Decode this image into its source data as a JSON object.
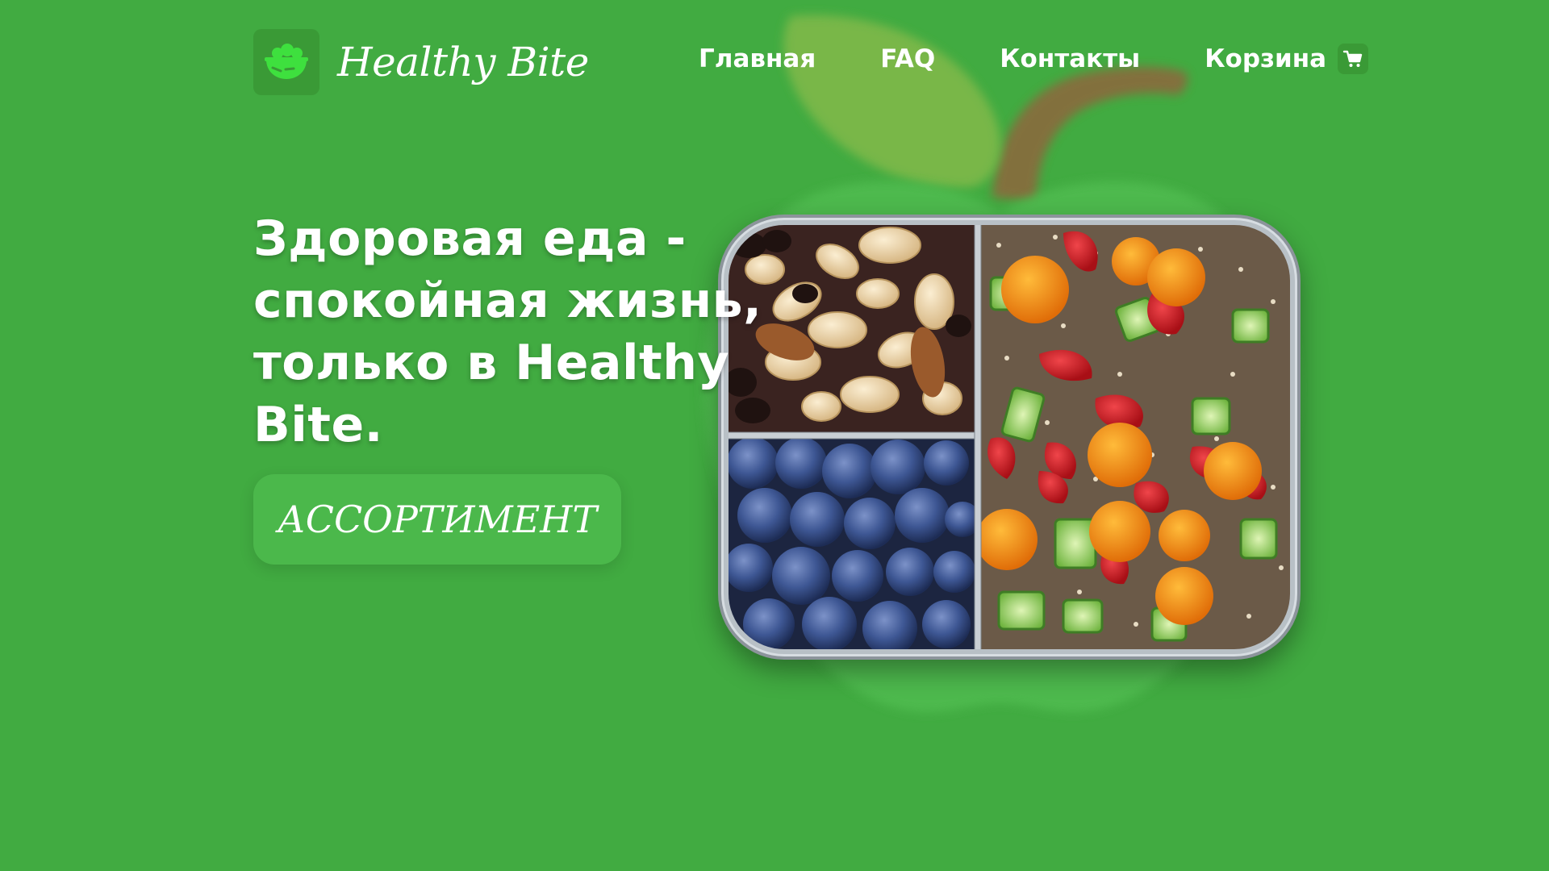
{
  "brand": {
    "name": "Healthy Bite",
    "logo_icon": "salad-bowl-icon"
  },
  "nav": {
    "items": [
      {
        "label": "Главная"
      },
      {
        "label": "FAQ"
      },
      {
        "label": "Контакты"
      },
      {
        "label": "Корзина"
      }
    ],
    "cart_icon": "cart-icon"
  },
  "hero": {
    "title": "Здоровая еда - спокойная жизнь, только в Healthy Bite.",
    "cta_label": "АССОРТИМЕНТ"
  },
  "colors": {
    "background": "#41ab41",
    "accent": "#4bb84b",
    "apple_leaf": "#7bb84a",
    "apple_stem": "#8a6a3d",
    "text": "#ffffff"
  }
}
